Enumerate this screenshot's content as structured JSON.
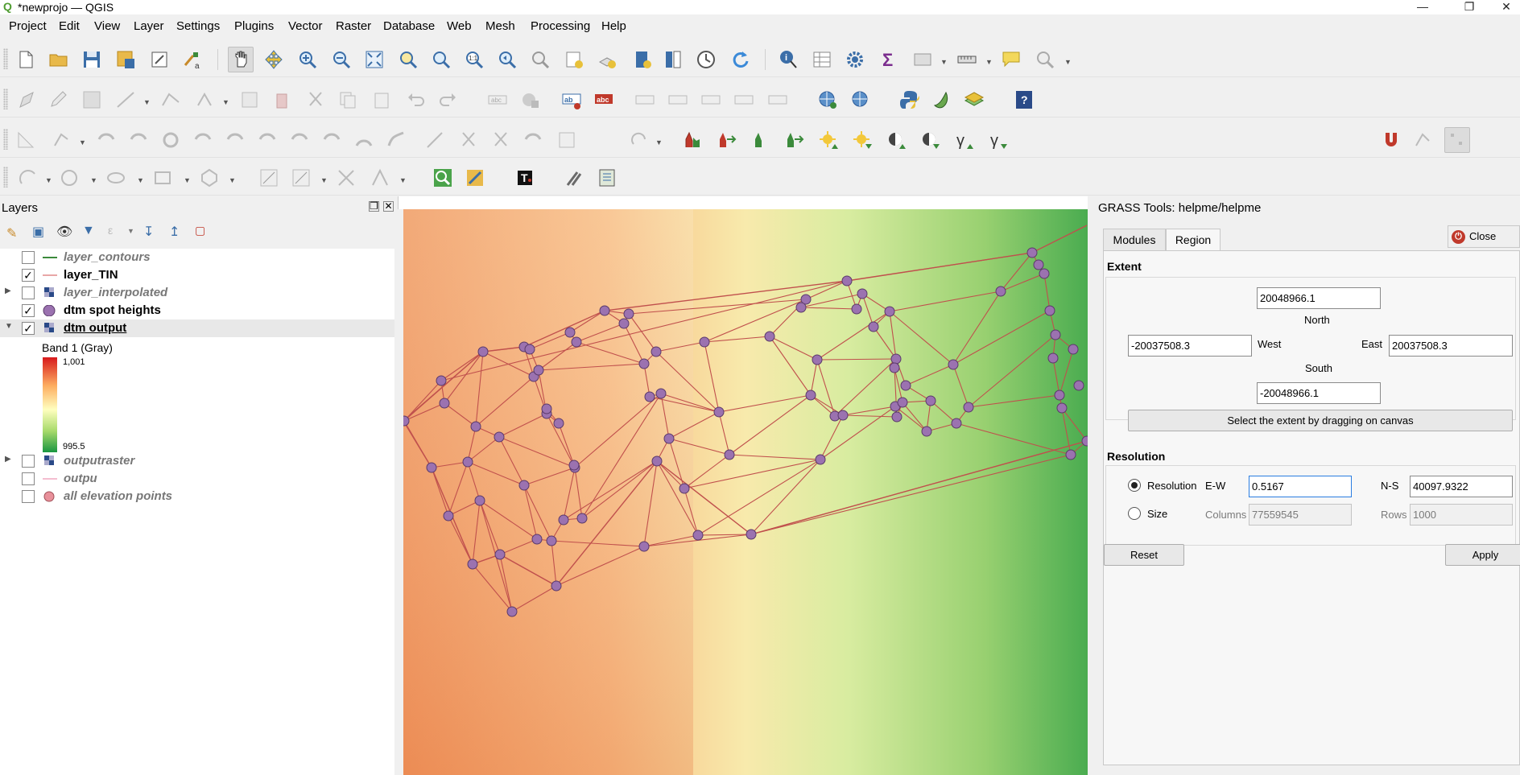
{
  "window": {
    "title": "*newprojo — QGIS"
  },
  "menu": [
    "Project",
    "Edit",
    "View",
    "Layer",
    "Settings",
    "Plugins",
    "Vector",
    "Raster",
    "Database",
    "Web",
    "Mesh",
    "Processing",
    "Help"
  ],
  "layers_panel": {
    "title": "Layers",
    "layers": [
      {
        "name": "layer_contours",
        "checked": false,
        "style": "italic",
        "symbol": "green-line-icon"
      },
      {
        "name": "layer_TIN",
        "checked": true,
        "style": "bold",
        "symbol": "red-line-icon"
      },
      {
        "name": "layer_interpolated",
        "checked": false,
        "style": "italic",
        "symbol": "raster-icon",
        "expandable": true
      },
      {
        "name": "dtm spot heights",
        "checked": true,
        "style": "bold",
        "symbol": "purple-point-icon"
      },
      {
        "name": "dtm output",
        "checked": true,
        "style": "bold-underline",
        "symbol": "raster-icon",
        "expanded": true
      },
      {
        "name": "outputraster",
        "checked": false,
        "style": "italic",
        "symbol": "raster-icon",
        "expandable": true
      },
      {
        "name": "outpu",
        "checked": false,
        "style": "italic",
        "symbol": "pink-line-icon"
      },
      {
        "name": "all elevation points",
        "checked": false,
        "style": "italic",
        "symbol": "pink-point-icon"
      }
    ],
    "legend": {
      "band": "Band 1 (Gray)",
      "max": "1,001",
      "min": "995.5"
    }
  },
  "grass": {
    "title": "GRASS Tools: helpme/helpme",
    "tabs": [
      "Modules",
      "Region"
    ],
    "close_maps": "Close maps",
    "extent_label": "Extent",
    "north_value": "20048966.1",
    "north_label": "North",
    "west_value": "-20037508.3",
    "west_label": "West",
    "east_label": "East",
    "east_value": "20037508.3",
    "south_label": "South",
    "south_value": "-20048966.1",
    "drag_button": "Select the extent by dragging on canvas",
    "resolution_label": "Resolution",
    "resolution_radio": "Resolution",
    "size_radio": "Size",
    "ew_label": "E-W",
    "ew_value": "0.5167",
    "ns_label": "N-S",
    "ns_value": "40097.9322",
    "columns_label": "Columns",
    "columns_value": "77559545",
    "rows_label": "Rows",
    "rows_value": "1000",
    "reset": "Reset",
    "apply": "Apply"
  },
  "colors": {
    "accent": "#2a7de1",
    "tin_edge": "#c0504d",
    "point_fill": "#9b72b0"
  }
}
